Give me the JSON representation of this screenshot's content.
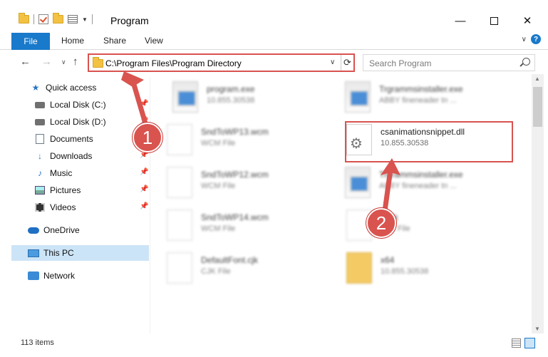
{
  "window": {
    "title": "Program",
    "controls": {
      "minimize": "—",
      "maximize": "",
      "close": "✕"
    }
  },
  "ribbon": {
    "tabs": [
      "File",
      "Home",
      "Share",
      "View"
    ],
    "help": "?"
  },
  "navigation": {
    "back": "←",
    "forward": "→",
    "recent": "∨",
    "up": "↑",
    "address": "C:\\Program Files\\Program Directory",
    "address_dropdown": "∨",
    "refresh": "⟳",
    "search_placeholder": "Search Program"
  },
  "sidebar": {
    "items": [
      {
        "label": "Quick access",
        "icon": "star-icon"
      },
      {
        "label": "Local Disk (C:)",
        "icon": "disk-icon"
      },
      {
        "label": "Local Disk (D:)",
        "icon": "disk-icon"
      },
      {
        "label": "Documents",
        "icon": "documents-icon"
      },
      {
        "label": "Downloads",
        "icon": "downloads-icon"
      },
      {
        "label": "Music",
        "icon": "music-icon"
      },
      {
        "label": "Pictures",
        "icon": "pictures-icon"
      },
      {
        "label": "Videos",
        "icon": "videos-icon"
      },
      {
        "label": "OneDrive",
        "icon": "onedrive-icon"
      },
      {
        "label": "This PC",
        "icon": "this-pc-icon"
      },
      {
        "label": "Network",
        "icon": "network-icon"
      }
    ],
    "selected": "This PC"
  },
  "files": [
    {
      "name": "program.exe",
      "sub": "10.855.30538",
      "kind": "exe"
    },
    {
      "name": "Trgrammsinstaller.exe",
      "sub": "ABBY fineneader tn ...",
      "kind": "exe"
    },
    {
      "name": "SndToWP13.wcm",
      "sub": "WCM File",
      "kind": "doc"
    },
    {
      "name": "csanimationsnippet.dll",
      "sub": "10.855.30538",
      "kind": "dll"
    },
    {
      "name": "SndToWP12.wcm",
      "sub": "WCM File",
      "kind": "doc"
    },
    {
      "name": "Trgrammsinstaller.exe",
      "sub": "ABBY fineneader tn ...",
      "kind": "exe"
    },
    {
      "name": "SndToWP14.wcm",
      "sub": "WCM File",
      "kind": "doc"
    },
    {
      "name": "n.cjk",
      "sub": "CJK File",
      "kind": "doc"
    },
    {
      "name": "DefaultFont.cjk",
      "sub": "CJK File",
      "kind": "doc"
    },
    {
      "name": "x64",
      "sub": "10.855.30538",
      "kind": "folder"
    }
  ],
  "status": {
    "items": "113 items"
  },
  "annotations": {
    "step1": "1",
    "step2": "2"
  },
  "colors": {
    "accent": "#1979ca",
    "highlight": "#d9534f",
    "selected": "#cce4f7"
  }
}
